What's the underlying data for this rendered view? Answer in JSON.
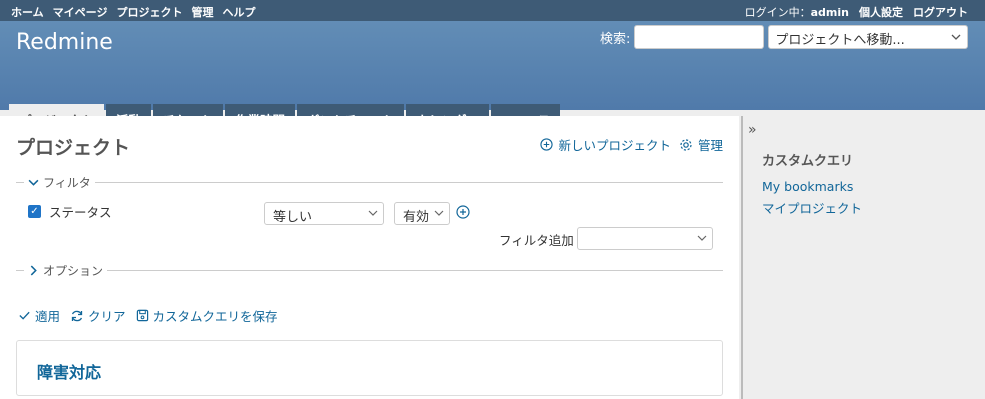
{
  "top_menu": {
    "items": [
      "ホーム",
      "マイページ",
      "プロジェクト",
      "管理",
      "ヘルプ"
    ],
    "login_label": "ログイン中：",
    "user": "admin",
    "account": "個人設定",
    "logout": "ログアウト"
  },
  "header": {
    "title": "Redmine",
    "search_label": "検索:",
    "search_value": "",
    "jump_label": "プロジェクトへ移動..."
  },
  "main_menu": {
    "tabs": [
      {
        "label": "プロジェクト",
        "selected": true
      },
      {
        "label": "活動",
        "selected": false
      },
      {
        "label": "チケット",
        "selected": false
      },
      {
        "label": "作業時間",
        "selected": false
      },
      {
        "label": "ガントチャート",
        "selected": false
      },
      {
        "label": "カレンダー",
        "selected": false
      },
      {
        "label": "ニュース",
        "selected": false
      }
    ]
  },
  "content": {
    "title": "プロジェクト",
    "new_project": "新しいプロジェクト",
    "admin": "管理",
    "filters_legend": "フィルタ",
    "status_filter": {
      "label": "ステータス",
      "checked": true,
      "operator": "等しい",
      "value": "有効"
    },
    "add_filter_label": "フィルタ追加",
    "add_filter_value": "",
    "options_legend": "オプション",
    "apply": "適用",
    "clear": "クリア",
    "save_query": "カスタムクエリを保存",
    "projects": [
      "障害対応"
    ]
  },
  "sidebar": {
    "heading": "カスタムクエリ",
    "links": [
      "My bookmarks",
      "マイプロジェクト"
    ]
  },
  "colors": {
    "top_menu_bg": "#3E5B76",
    "header_bg": "#628DB6",
    "link": "#116699",
    "checkbox": "#1F74C7"
  }
}
